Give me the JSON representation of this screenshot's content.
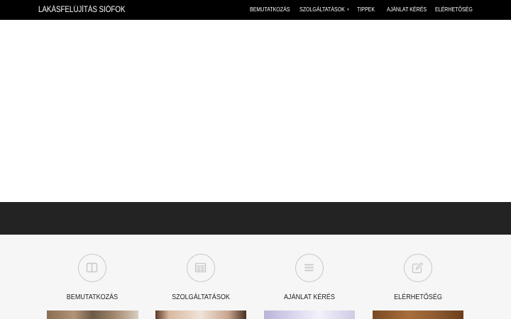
{
  "navbar": {
    "brand": "LAKÁSFELÚJÍTÁS SIÓFOK",
    "items": [
      {
        "label": "BEMUTATKOZÁS"
      },
      {
        "label": "SZOLGÁLTATÁSOK",
        "has_dropdown": true
      },
      {
        "label": "TIPPEK"
      },
      {
        "label": "AJÁNLAT KÉRÉS"
      },
      {
        "label": "ELÉRHETŐSÉG"
      }
    ]
  },
  "features": [
    {
      "title": "BEMUTATKOZÁS",
      "icon": "columns-icon"
    },
    {
      "title": "SZOLGÁLTATÁSOK",
      "icon": "table-icon"
    },
    {
      "title": "AJÁNLAT KÉRÉS",
      "icon": "list-icon"
    },
    {
      "title": "ELÉRHETŐSÉG",
      "icon": "edit-icon"
    }
  ],
  "colors": {
    "navbar_bg": "#000000",
    "band_bg": "#232323",
    "features_bg": "#f6f6f6",
    "icon_stroke": "#c8c8c8"
  }
}
